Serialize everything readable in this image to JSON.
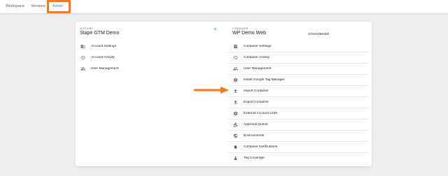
{
  "tabs": {
    "workspace": "Workspace",
    "versions": "Versions",
    "admin": "Admin"
  },
  "account": {
    "label": "ACCOUNT",
    "name": "Stape GTM Demo",
    "items": [
      {
        "label": "Account Settings",
        "icon": "building-icon"
      },
      {
        "label": "Account Activity",
        "icon": "history-icon"
      },
      {
        "label": "User Management",
        "icon": "people-icon"
      }
    ]
  },
  "container": {
    "label": "CONTAINER",
    "name": "WP Demo Web",
    "id": "GTM-KZ6S45Z",
    "items": [
      {
        "label": "Container Settings",
        "icon": "container-icon"
      },
      {
        "label": "Container Activity",
        "icon": "history-icon"
      },
      {
        "label": "User Management",
        "icon": "people-icon"
      },
      {
        "label": "Install Google Tag Manager",
        "icon": "gear-icon"
      },
      {
        "label": "Import Container",
        "icon": "upload-icon"
      },
      {
        "label": "Export Container",
        "icon": "download-icon"
      },
      {
        "label": "External Account Links",
        "icon": "gear-icon"
      },
      {
        "label": "Approval Queue",
        "icon": "gavel-icon"
      },
      {
        "label": "Environments",
        "icon": "globe-icon"
      },
      {
        "label": "Container Notifications",
        "icon": "bell-icon"
      },
      {
        "label": "Tag Coverage",
        "icon": "flask-icon"
      }
    ]
  },
  "colors": {
    "accent": "#4285f4",
    "highlight": "#f47920"
  }
}
